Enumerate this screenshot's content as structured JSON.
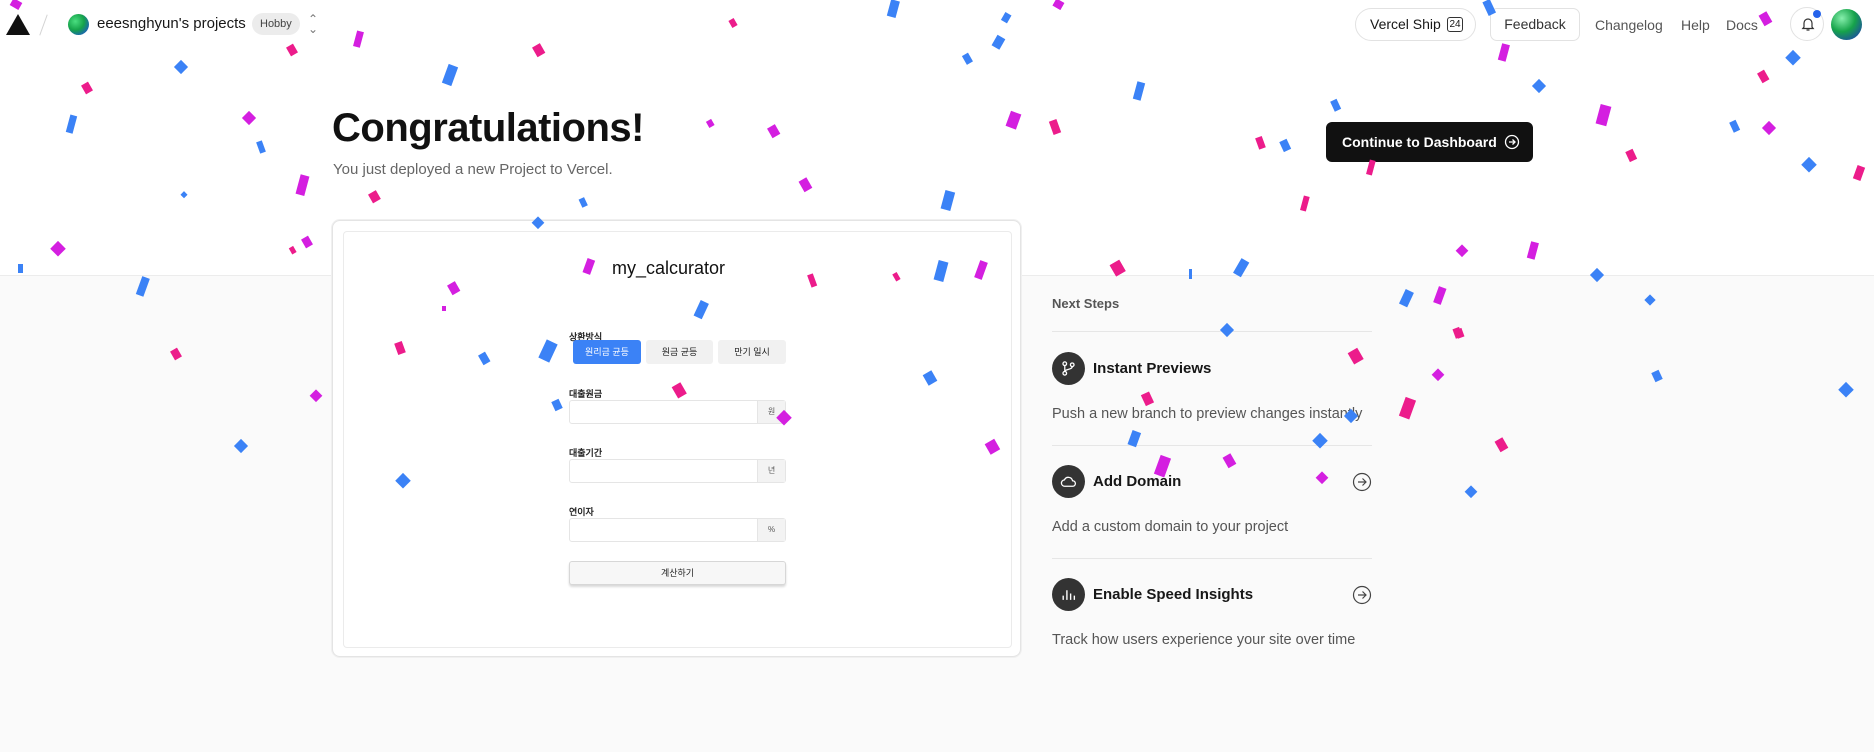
{
  "header": {
    "team_name": "eeesnghyun's projects",
    "plan_badge": "Hobby",
    "ship_label": "Vercel Ship",
    "ship_badge": "24",
    "feedback_label": "Feedback",
    "links": [
      "Changelog",
      "Help",
      "Docs"
    ]
  },
  "hero": {
    "title": "Congratulations!",
    "subtitle": "You just deployed a new Project to Vercel.",
    "dashboard_button": "Continue to Dashboard"
  },
  "preview": {
    "app_title": "my_calcurator",
    "repayment_label": "상환방식",
    "repayment_options": [
      "원리금 균등",
      "원금 균등",
      "만기 일시"
    ],
    "principal_label": "대출원금",
    "principal_unit": "원",
    "period_label": "대출기간",
    "period_unit": "년",
    "rate_label": "연이자",
    "rate_unit": "%",
    "calculate_button": "계산하기"
  },
  "next_steps": {
    "title": "Next Steps",
    "items": [
      {
        "icon": "git-branch-icon",
        "title": "Instant Previews",
        "description": "Push a new branch to preview changes instantly"
      },
      {
        "icon": "cloud-icon",
        "title": "Add Domain",
        "description": "Add a custom domain to your project"
      },
      {
        "icon": "bar-chart-icon",
        "title": "Enable Speed Insights",
        "description": "Track how users experience your site over time"
      }
    ]
  },
  "colors": {
    "confetti": [
      "#3b82f6",
      "#ec1c8b",
      "#d41fe0"
    ],
    "primary_button": "#111111",
    "segment_active": "#3b82f6"
  }
}
